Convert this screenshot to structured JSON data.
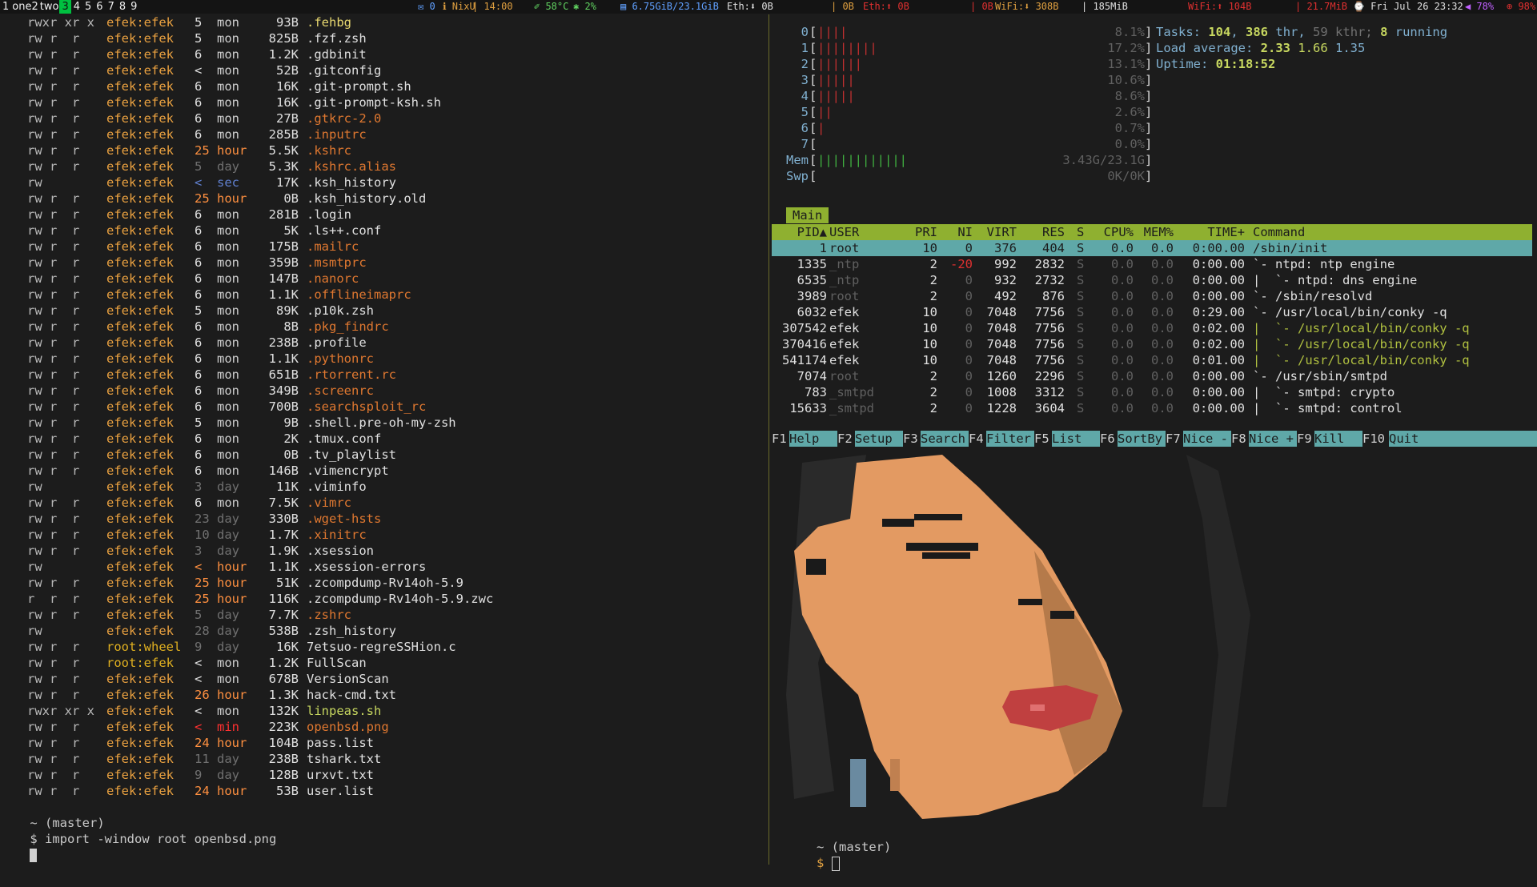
{
  "topbar": {
    "workspaces": [
      {
        "label": "1",
        "active": false
      },
      {
        "label": "one2",
        "active": false
      },
      {
        "label": "two",
        "active": false
      },
      {
        "label": "3",
        "active": true
      },
      {
        "label": "4",
        "active": false
      },
      {
        "label": "5",
        "active": false
      },
      {
        "label": "6",
        "active": false
      },
      {
        "label": "7",
        "active": false
      },
      {
        "label": "8",
        "active": false
      },
      {
        "label": "9",
        "active": false
      }
    ],
    "status": [
      {
        "text": "✉ 0",
        "color": "#60a0ff"
      },
      {
        "text": "ℹ NixU",
        "color": "#e0a040"
      },
      {
        "text": "| 14:00",
        "color": "#e0a040"
      },
      {
        "text": "✐ 58°C",
        "color": "#60d060"
      },
      {
        "text": "✱ 2%",
        "color": "#60d060"
      },
      {
        "text": "▤ 6.75GiB/23.1GiB",
        "color": "#60a0ff"
      },
      {
        "text": "Eth:⬇ 0B",
        "color": "#e0e0e0"
      },
      {
        "text": "| 0B",
        "color": "#e0a040"
      },
      {
        "text": "Eth:⬆ 0B",
        "color": "#e03030"
      },
      {
        "text": "| 0B",
        "color": "#e03030"
      },
      {
        "text": "WiFi:⬇ 308B",
        "color": "#e0a040"
      },
      {
        "text": "| 185MiB",
        "color": "#e0e0e0"
      },
      {
        "text": "WiFi:⬆ 104B",
        "color": "#e03030"
      },
      {
        "text": "| 21.7MiB",
        "color": "#e03030"
      },
      {
        "text": "⌚ Fri Jul 26 23:32",
        "color": "#e0e0e0"
      },
      {
        "text": "◀ 78%",
        "color": "#c060ff"
      },
      {
        "text": "⊕ 98%",
        "color": "#e03030"
      }
    ]
  },
  "left": {
    "files": [
      {
        "perm": "rwxr xr x",
        "owner": "efek:efek",
        "n": "5",
        "u": "mon",
        "size": "93B",
        "name": ".fehbg"
      },
      {
        "perm": "rw r  r",
        "owner": "efek:efek",
        "n": "5",
        "u": "mon",
        "size": "825B",
        "name": ".fzf.zsh"
      },
      {
        "perm": "rw r  r",
        "owner": "efek:efek",
        "n": "6",
        "u": "mon",
        "size": "1.2K",
        "name": ".gdbinit"
      },
      {
        "perm": "rw r  r",
        "owner": "efek:efek",
        "n": "<",
        "u": "mon",
        "size": "52B",
        "name": ".gitconfig"
      },
      {
        "perm": "rw r  r",
        "owner": "efek:efek",
        "n": "6",
        "u": "mon",
        "size": "16K",
        "name": ".git-prompt.sh"
      },
      {
        "perm": "rw r  r",
        "owner": "efek:efek",
        "n": "6",
        "u": "mon",
        "size": "16K",
        "name": ".git-prompt-ksh.sh"
      },
      {
        "perm": "rw r  r",
        "owner": "efek:efek",
        "n": "6",
        "u": "mon",
        "size": "27B",
        "name": ".gtkrc-2.0"
      },
      {
        "perm": "rw r  r",
        "owner": "efek:efek",
        "n": "6",
        "u": "mon",
        "size": "285B",
        "name": ".inputrc"
      },
      {
        "perm": "rw r  r",
        "owner": "efek:efek",
        "n": "25",
        "u": "hour",
        "size": "5.5K",
        "name": ".kshrc"
      },
      {
        "perm": "rw r  r",
        "owner": "efek:efek",
        "n": "5",
        "u": "day",
        "size": "5.3K",
        "name": ".kshrc.alias"
      },
      {
        "perm": "rw",
        "owner": "efek:efek",
        "n": "<",
        "u": "sec",
        "size": "17K",
        "name": ".ksh_history"
      },
      {
        "perm": "rw r  r",
        "owner": "efek:efek",
        "n": "25",
        "u": "hour",
        "size": "0B",
        "name": ".ksh_history.old"
      },
      {
        "perm": "rw r  r",
        "owner": "efek:efek",
        "n": "6",
        "u": "mon",
        "size": "281B",
        "name": ".login"
      },
      {
        "perm": "rw r  r",
        "owner": "efek:efek",
        "n": "6",
        "u": "mon",
        "size": "5K",
        "name": ".ls++.conf"
      },
      {
        "perm": "rw r  r",
        "owner": "efek:efek",
        "n": "6",
        "u": "mon",
        "size": "175B",
        "name": ".mailrc"
      },
      {
        "perm": "rw r  r",
        "owner": "efek:efek",
        "n": "6",
        "u": "mon",
        "size": "359B",
        "name": ".msmtprc"
      },
      {
        "perm": "rw r  r",
        "owner": "efek:efek",
        "n": "6",
        "u": "mon",
        "size": "147B",
        "name": ".nanorc"
      },
      {
        "perm": "rw r  r",
        "owner": "efek:efek",
        "n": "6",
        "u": "mon",
        "size": "1.1K",
        "name": ".offlineimaprc"
      },
      {
        "perm": "rw r  r",
        "owner": "efek:efek",
        "n": "5",
        "u": "mon",
        "size": "89K",
        "name": ".p10k.zsh"
      },
      {
        "perm": "rw r  r",
        "owner": "efek:efek",
        "n": "6",
        "u": "mon",
        "size": "8B",
        "name": ".pkg_findrc"
      },
      {
        "perm": "rw r  r",
        "owner": "efek:efek",
        "n": "6",
        "u": "mon",
        "size": "238B",
        "name": ".profile"
      },
      {
        "perm": "rw r  r",
        "owner": "efek:efek",
        "n": "6",
        "u": "mon",
        "size": "1.1K",
        "name": ".pythonrc"
      },
      {
        "perm": "rw r  r",
        "owner": "efek:efek",
        "n": "6",
        "u": "mon",
        "size": "651B",
        "name": ".rtorrent.rc"
      },
      {
        "perm": "rw r  r",
        "owner": "efek:efek",
        "n": "6",
        "u": "mon",
        "size": "349B",
        "name": ".screenrc"
      },
      {
        "perm": "rw r  r",
        "owner": "efek:efek",
        "n": "6",
        "u": "mon",
        "size": "700B",
        "name": ".searchsploit_rc"
      },
      {
        "perm": "rw r  r",
        "owner": "efek:efek",
        "n": "5",
        "u": "mon",
        "size": "9B",
        "name": ".shell.pre-oh-my-zsh"
      },
      {
        "perm": "rw r  r",
        "owner": "efek:efek",
        "n": "6",
        "u": "mon",
        "size": "2K",
        "name": ".tmux.conf"
      },
      {
        "perm": "rw r  r",
        "owner": "efek:efek",
        "n": "6",
        "u": "mon",
        "size": "0B",
        "name": ".tv_playlist"
      },
      {
        "perm": "rw r  r",
        "owner": "efek:efek",
        "n": "6",
        "u": "mon",
        "size": "146B",
        "name": ".vimencrypt"
      },
      {
        "perm": "rw",
        "owner": "efek:efek",
        "n": "3",
        "u": "day",
        "size": "11K",
        "name": ".viminfo"
      },
      {
        "perm": "rw r  r",
        "owner": "efek:efek",
        "n": "6",
        "u": "mon",
        "size": "7.5K",
        "name": ".vimrc"
      },
      {
        "perm": "rw r  r",
        "owner": "efek:efek",
        "n": "23",
        "u": "day",
        "size": "330B",
        "name": ".wget-hsts"
      },
      {
        "perm": "rw r  r",
        "owner": "efek:efek",
        "n": "10",
        "u": "day",
        "size": "1.7K",
        "name": ".xinitrc"
      },
      {
        "perm": "rw r  r",
        "owner": "efek:efek",
        "n": "3",
        "u": "day",
        "size": "1.9K",
        "name": ".xsession"
      },
      {
        "perm": "rw",
        "owner": "efek:efek",
        "n": "<",
        "u": "hour",
        "size": "1.1K",
        "name": ".xsession-errors"
      },
      {
        "perm": "rw r  r",
        "owner": "efek:efek",
        "n": "25",
        "u": "hour",
        "size": "51K",
        "name": ".zcompdump-Rv14oh-5.9"
      },
      {
        "perm": "r  r  r",
        "owner": "efek:efek",
        "n": "25",
        "u": "hour",
        "size": "116K",
        "name": ".zcompdump-Rv14oh-5.9.zwc"
      },
      {
        "perm": "rw r  r",
        "owner": "efek:efek",
        "n": "5",
        "u": "day",
        "size": "7.7K",
        "name": ".zshrc"
      },
      {
        "perm": "rw",
        "owner": "efek:efek",
        "n": "28",
        "u": "day",
        "size": "538B",
        "name": ".zsh_history"
      },
      {
        "perm": "rw r  r",
        "owner": "root:wheel",
        "n": "9",
        "u": "day",
        "size": "16K",
        "name": "7etsuo-regreSSHion.c"
      },
      {
        "perm": "rw r  r",
        "owner": "root:efek",
        "n": "<",
        "u": "mon",
        "size": "1.2K",
        "name": "FullScan"
      },
      {
        "perm": "rw r  r",
        "owner": "efek:efek",
        "n": "<",
        "u": "mon",
        "size": "678B",
        "name": "VersionScan"
      },
      {
        "perm": "rw r  r",
        "owner": "efek:efek",
        "n": "26",
        "u": "hour",
        "size": "1.3K",
        "name": "hack-cmd.txt"
      },
      {
        "perm": "rwxr xr x",
        "owner": "efek:efek",
        "n": "<",
        "u": "mon",
        "size": "132K",
        "name": "linpeas.sh"
      },
      {
        "perm": "rw r  r",
        "owner": "efek:efek",
        "n": "<",
        "u": "min",
        "size": "223K",
        "name": "openbsd.png"
      },
      {
        "perm": "rw r  r",
        "owner": "efek:efek",
        "n": "24",
        "u": "hour",
        "size": "104B",
        "name": "pass.list"
      },
      {
        "perm": "rw r  r",
        "owner": "efek:efek",
        "n": "11",
        "u": "day",
        "size": "238B",
        "name": "tshark.txt"
      },
      {
        "perm": "rw r  r",
        "owner": "efek:efek",
        "n": "9",
        "u": "day",
        "size": "128B",
        "name": "urxvt.txt"
      },
      {
        "perm": "rw r  r",
        "owner": "efek:efek",
        "n": "24",
        "u": "hour",
        "size": "53B",
        "name": "user.list"
      }
    ],
    "prompt_dir": "~ (master)",
    "prompt_symbol": "$",
    "command": "import -window root openbsd.png"
  },
  "htop": {
    "cpus": [
      {
        "label": "0",
        "bars": "||||",
        "pct": "8.1%"
      },
      {
        "label": "1",
        "bars": "||||||||",
        "pct": "17.2%"
      },
      {
        "label": "2",
        "bars": "||||||",
        "pct": "13.1%"
      },
      {
        "label": "3",
        "bars": "|||||",
        "pct": "10.6%"
      },
      {
        "label": "4",
        "bars": "|||||",
        "pct": "8.6%"
      },
      {
        "label": "5",
        "bars": "||",
        "pct": "2.6%"
      },
      {
        "label": "6",
        "bars": "|",
        "pct": "0.7%"
      },
      {
        "label": "7",
        "bars": "",
        "pct": "0.0%"
      }
    ],
    "mem": {
      "label": "Mem",
      "bars": "||||||||||||",
      "value": "3.43G/23.1G"
    },
    "swp": {
      "label": "Swp",
      "bars": "",
      "value": "0K/0K"
    },
    "tasks_label": "Tasks:",
    "tasks": "104",
    "threads": "386",
    "thr_label": "thr,",
    "kthr": "59",
    "kthr_label": "kthr;",
    "running": "8",
    "running_label": "running",
    "load_label": "Load average:",
    "load1": "2.33",
    "load5": "1.66",
    "load15": "1.35",
    "uptime_label": "Uptime:",
    "uptime": "01:18:52",
    "tab": "Main",
    "columns": [
      "PID▲",
      "USER",
      "PRI",
      "NI",
      "VIRT",
      "RES",
      "S",
      "CPU%",
      "MEM%",
      "TIME+",
      "Command"
    ],
    "procs": [
      {
        "pid": "1",
        "user": "root",
        "pri": "10",
        "ni": "0",
        "virt": "376",
        "res": "404",
        "s": "S",
        "cpu": "0.0",
        "mem": "0.0",
        "time": "0:00.00",
        "cmd": "/sbin/init",
        "sel": true,
        "dim": false,
        "cmdcolor": "#1c1c1c"
      },
      {
        "pid": "1335",
        "user": "_ntp",
        "pri": "2",
        "ni": "-20",
        "virt": "992",
        "res": "2832",
        "s": "S",
        "cpu": "0.0",
        "mem": "0.0",
        "time": "0:00.00",
        "cmd": "`- ntpd: ntp engine",
        "sel": false,
        "dim": true,
        "cmdcolor": "#e0e0e0"
      },
      {
        "pid": "6535",
        "user": "_ntp",
        "pri": "2",
        "ni": "0",
        "virt": "932",
        "res": "2732",
        "s": "S",
        "cpu": "0.0",
        "mem": "0.0",
        "time": "0:00.00",
        "cmd": "|  `- ntpd: dns engine",
        "sel": false,
        "dim": true,
        "cmdcolor": "#e0e0e0"
      },
      {
        "pid": "3989",
        "user": "root",
        "pri": "2",
        "ni": "0",
        "virt": "492",
        "res": "876",
        "s": "S",
        "cpu": "0.0",
        "mem": "0.0",
        "time": "0:00.00",
        "cmd": "`- /sbin/resolvd",
        "sel": false,
        "dim": true,
        "cmdcolor": "#e0e0e0"
      },
      {
        "pid": "6032",
        "user": "efek",
        "pri": "10",
        "ni": "0",
        "virt": "7048",
        "res": "7756",
        "s": "S",
        "cpu": "0.0",
        "mem": "0.0",
        "time": "0:29.00",
        "cmd": "`- /usr/local/bin/conky -q",
        "sel": false,
        "dim": false,
        "cmdcolor": "#e0e0e0"
      },
      {
        "pid": "307542",
        "user": "efek",
        "pri": "10",
        "ni": "0",
        "virt": "7048",
        "res": "7756",
        "s": "S",
        "cpu": "0.0",
        "mem": "0.0",
        "time": "0:02.00",
        "cmd": "|  `- /usr/local/bin/conky -q",
        "sel": false,
        "dim": false,
        "cmdcolor": "#b0c040"
      },
      {
        "pid": "370416",
        "user": "efek",
        "pri": "10",
        "ni": "0",
        "virt": "7048",
        "res": "7756",
        "s": "S",
        "cpu": "0.0",
        "mem": "0.0",
        "time": "0:02.00",
        "cmd": "|  `- /usr/local/bin/conky -q",
        "sel": false,
        "dim": false,
        "cmdcolor": "#b0c040"
      },
      {
        "pid": "541174",
        "user": "efek",
        "pri": "10",
        "ni": "0",
        "virt": "7048",
        "res": "7756",
        "s": "S",
        "cpu": "0.0",
        "mem": "0.0",
        "time": "0:01.00",
        "cmd": "|  `- /usr/local/bin/conky -q",
        "sel": false,
        "dim": false,
        "cmdcolor": "#b0c040"
      },
      {
        "pid": "7074",
        "user": "root",
        "pri": "2",
        "ni": "0",
        "virt": "1260",
        "res": "2296",
        "s": "S",
        "cpu": "0.0",
        "mem": "0.0",
        "time": "0:00.00",
        "cmd": "`- /usr/sbin/smtpd",
        "sel": false,
        "dim": true,
        "cmdcolor": "#e0e0e0"
      },
      {
        "pid": "783",
        "user": "_smtpd",
        "pri": "2",
        "ni": "0",
        "virt": "1008",
        "res": "3312",
        "s": "S",
        "cpu": "0.0",
        "mem": "0.0",
        "time": "0:00.00",
        "cmd": "|  `- smtpd: crypto",
        "sel": false,
        "dim": true,
        "cmdcolor": "#e0e0e0"
      },
      {
        "pid": "15633",
        "user": "_smtpd",
        "pri": "2",
        "ni": "0",
        "virt": "1228",
        "res": "3604",
        "s": "S",
        "cpu": "0.0",
        "mem": "0.0",
        "time": "0:00.00",
        "cmd": "|  `- smtpd: control",
        "sel": false,
        "dim": true,
        "cmdcolor": "#e0e0e0"
      }
    ],
    "fkeys": [
      {
        "key": "F1",
        "label": "Help"
      },
      {
        "key": "F2",
        "label": "Setup"
      },
      {
        "key": "F3",
        "label": "Search"
      },
      {
        "key": "F4",
        "label": "Filter"
      },
      {
        "key": "F5",
        "label": "List"
      },
      {
        "key": "F6",
        "label": "SortBy"
      },
      {
        "key": "F7",
        "label": "Nice -"
      },
      {
        "key": "F8",
        "label": "Nice +"
      },
      {
        "key": "F9",
        "label": "Kill"
      },
      {
        "key": "F10",
        "label": "Quit"
      }
    ]
  },
  "right": {
    "prompt_dir": "~ (master)",
    "prompt_symbol": "$"
  }
}
